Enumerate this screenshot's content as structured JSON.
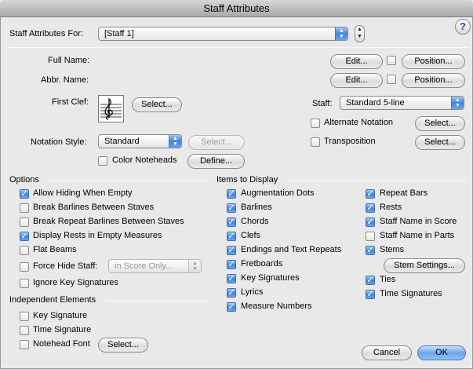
{
  "window": {
    "title": "Staff Attributes"
  },
  "top": {
    "for_label": "Staff Attributes For:",
    "staff_select": "[Staff 1]",
    "help": "?"
  },
  "names": {
    "full_name_label": "Full Name:",
    "abbr_name_label": "Abbr. Name:",
    "edit_label": "Edit...",
    "position_label": "Position..."
  },
  "clef": {
    "first_clef_label": "First Clef:",
    "select_label": "Select..."
  },
  "staff": {
    "label": "Staff:",
    "value": "Standard 5-line",
    "alternate_notation": "Alternate Notation",
    "transposition": "Transposition",
    "select_label": "Select..."
  },
  "notation": {
    "style_label": "Notation Style:",
    "style_value": "Standard",
    "select_label": "Select...",
    "color_noteheads": "Color Noteheads",
    "define_label": "Define..."
  },
  "options": {
    "title": "Options",
    "items": [
      {
        "label": "Allow Hiding When Empty",
        "checked": true
      },
      {
        "label": "Break Barlines Between Staves",
        "checked": false
      },
      {
        "label": "Break Repeat Barlines Between Staves",
        "checked": false
      },
      {
        "label": "Display Rests in Empty Measures",
        "checked": true
      },
      {
        "label": "Flat Beams",
        "checked": false
      },
      {
        "label": "Force Hide Staff:",
        "checked": false
      },
      {
        "label": "Ignore Key Signatures",
        "checked": false
      }
    ],
    "force_hide_value": "in Score Only..."
  },
  "independent": {
    "title": "Independent Elements",
    "items": [
      {
        "label": "Key Signature",
        "checked": false
      },
      {
        "label": "Time Signature",
        "checked": false
      },
      {
        "label": "Notehead Font",
        "checked": false
      }
    ],
    "select_label": "Select..."
  },
  "display": {
    "title": "Items to Display",
    "col1": [
      {
        "label": "Augmentation Dots",
        "checked": true
      },
      {
        "label": "Barlines",
        "checked": true
      },
      {
        "label": "Chords",
        "checked": true
      },
      {
        "label": "Clefs",
        "checked": true
      },
      {
        "label": "Endings and Text Repeats",
        "checked": true
      },
      {
        "label": "Fretboards",
        "checked": true
      },
      {
        "label": "Key Signatures",
        "checked": true
      },
      {
        "label": "Lyrics",
        "checked": true
      },
      {
        "label": "Measure Numbers",
        "checked": true
      }
    ],
    "col2": [
      {
        "label": "Repeat Bars",
        "checked": true
      },
      {
        "label": "Rests",
        "checked": true
      },
      {
        "label": "Staff Name in Score",
        "checked": true
      },
      {
        "label": "Staff Name in Parts",
        "checked": false
      },
      {
        "label": "Stems",
        "checked": true
      }
    ],
    "stem_settings_label": "Stem Settings...",
    "col2b": [
      {
        "label": "Ties",
        "checked": true
      },
      {
        "label": "Time Signatures",
        "checked": true
      }
    ]
  },
  "footer": {
    "cancel_label": "Cancel",
    "ok_label": "OK"
  },
  "colors": {
    "accent": "#3b82da"
  }
}
